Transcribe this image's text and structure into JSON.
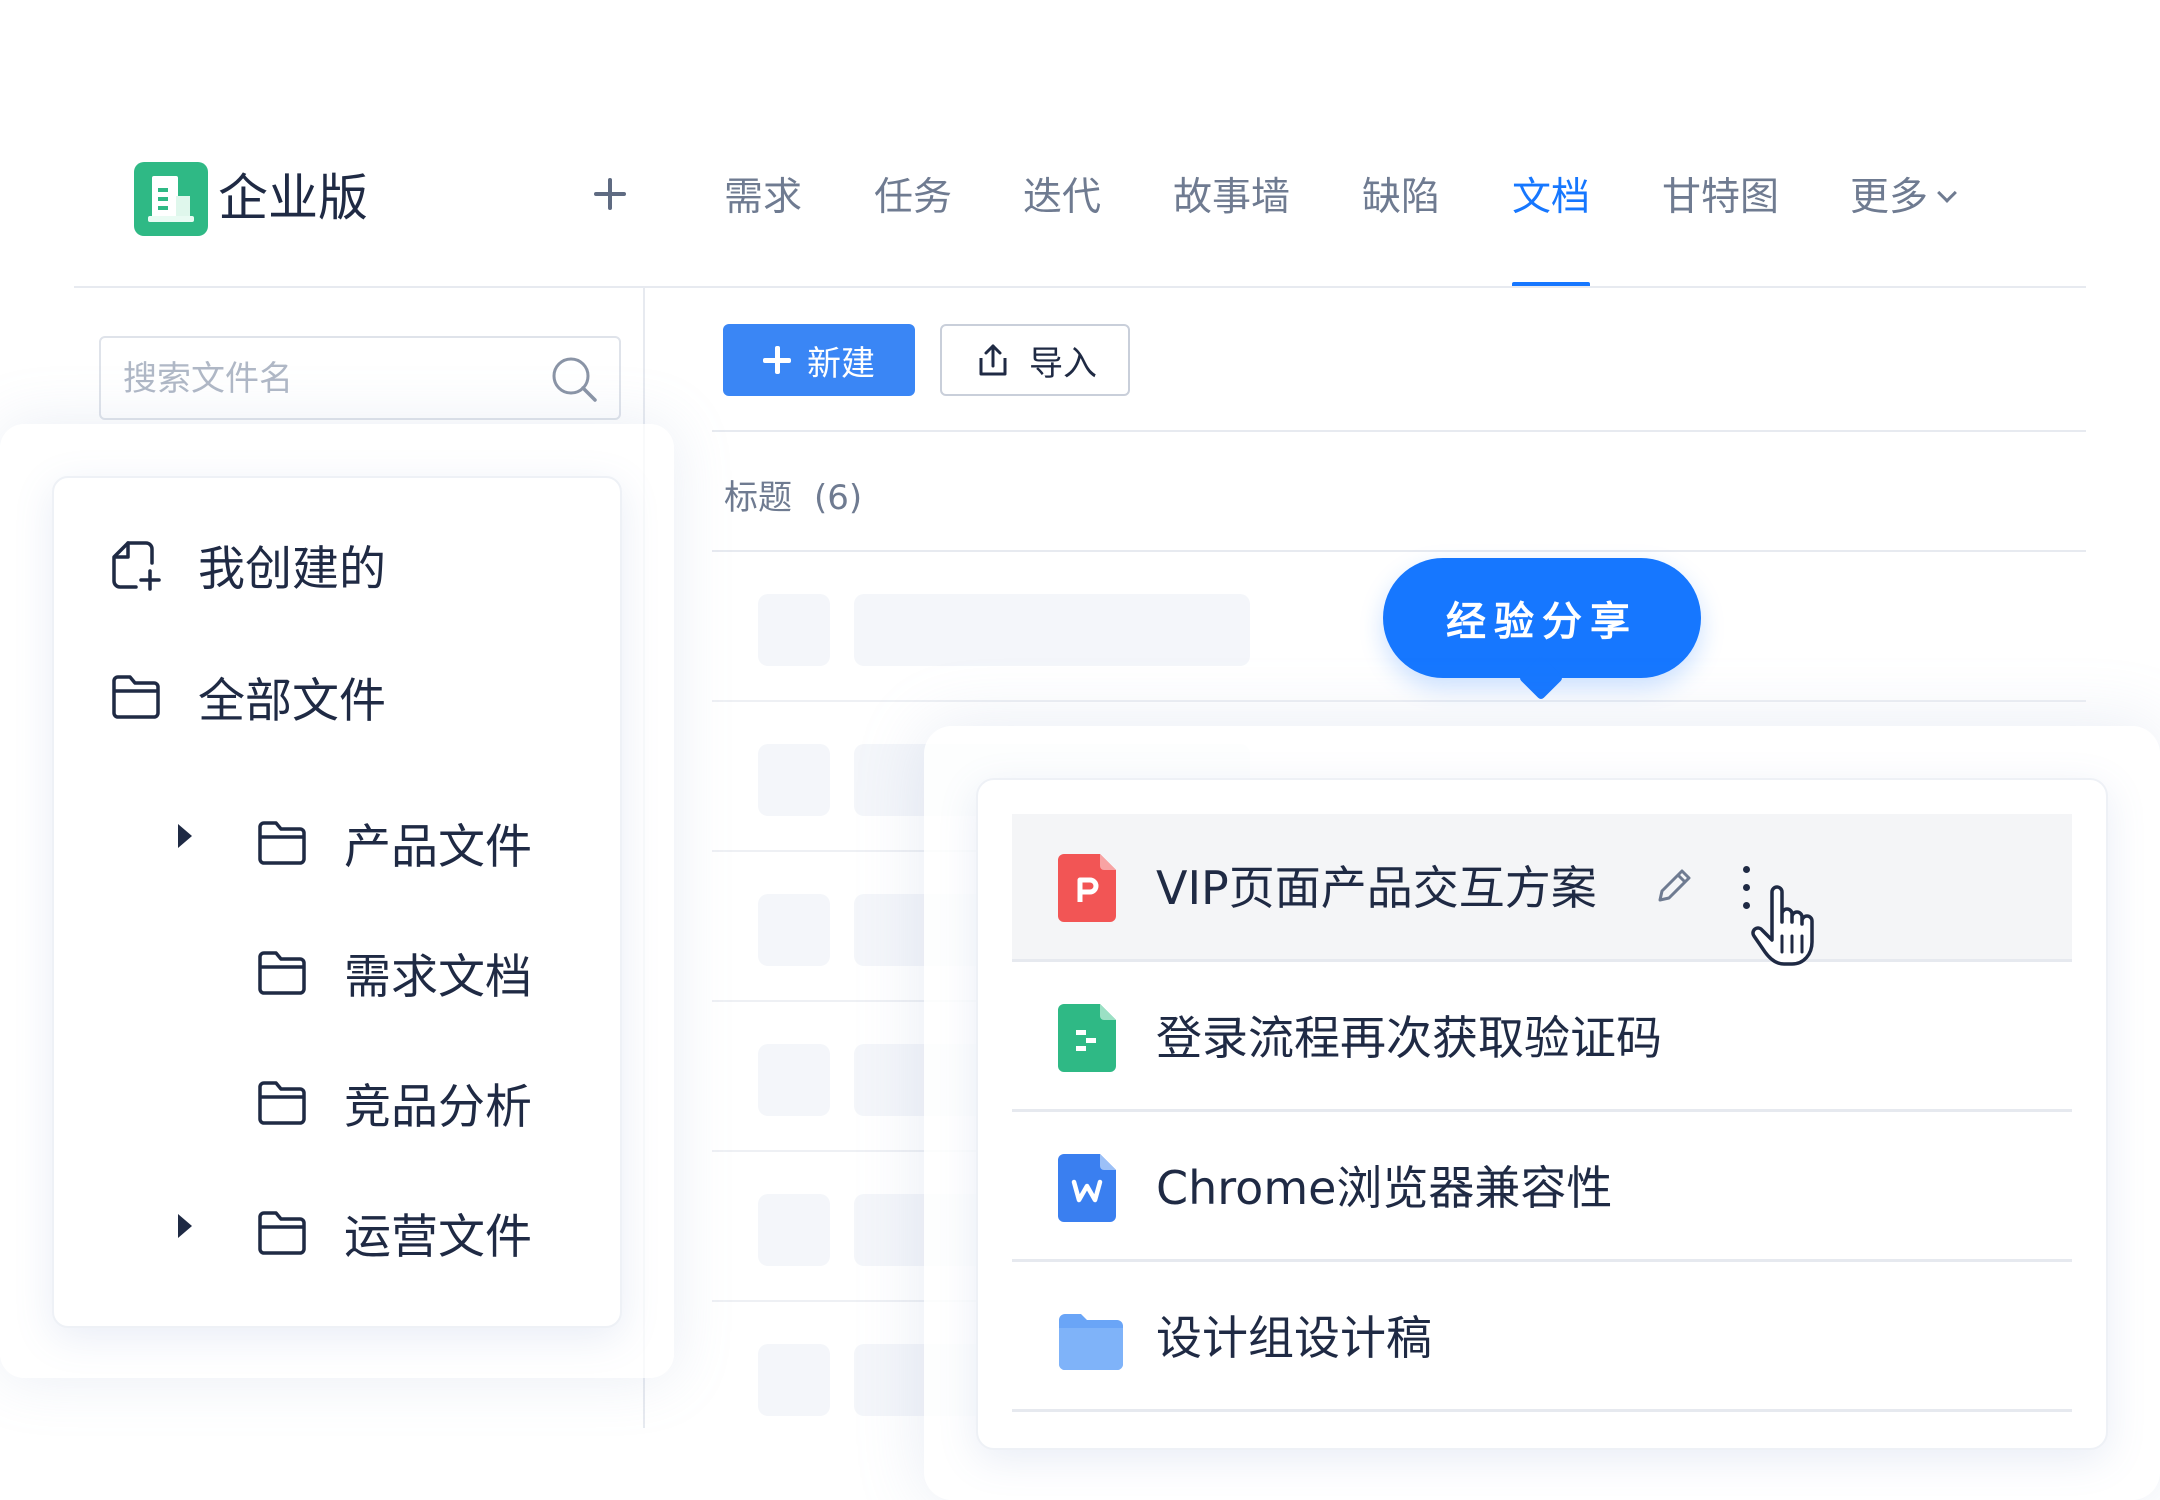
{
  "header": {
    "edition_label": "企业版",
    "add_tab_icon": "plus-icon",
    "tabs": [
      {
        "label": "需求",
        "active": false
      },
      {
        "label": "任务",
        "active": false
      },
      {
        "label": "迭代",
        "active": false
      },
      {
        "label": "故事墙",
        "active": false
      },
      {
        "label": "缺陷",
        "active": false
      },
      {
        "label": "文档",
        "active": true
      },
      {
        "label": "甘特图",
        "active": false
      },
      {
        "label": "更多",
        "active": false
      }
    ],
    "accent_color": "#1677ff",
    "logo_color": "#2fb985"
  },
  "sidebar": {
    "search_placeholder": "搜索文件名",
    "items": [
      {
        "label": "我创建的",
        "icon": "file-add-icon"
      },
      {
        "label": "全部文件",
        "icon": "folder-icon"
      }
    ],
    "folders": [
      {
        "label": "产品文件",
        "expandable": true
      },
      {
        "label": "需求文档",
        "expandable": false
      },
      {
        "label": "竞品分析",
        "expandable": false
      },
      {
        "label": "运营文件",
        "expandable": true
      }
    ]
  },
  "toolbar": {
    "new_label": "新建",
    "import_label": "导入"
  },
  "list": {
    "header_title": "标题",
    "count": "(6)"
  },
  "tooltip": {
    "label": "经验分享"
  },
  "documents": [
    {
      "name": "VIP页面产品交互方案",
      "type": "ppt",
      "icon": "ppt-file-icon",
      "color": "#f25555",
      "hovered": true
    },
    {
      "name": "登录流程再次获取验证码",
      "type": "sheet",
      "icon": "mindmap-file-icon",
      "color": "#2fb985",
      "hovered": false
    },
    {
      "name": "Chrome浏览器兼容性",
      "type": "word",
      "icon": "word-file-icon",
      "color": "#3a7ff0",
      "hovered": false
    },
    {
      "name": "设计组设计稿",
      "type": "folder",
      "icon": "folder-filled-icon",
      "color": "#6aa5f7",
      "hovered": false
    }
  ]
}
